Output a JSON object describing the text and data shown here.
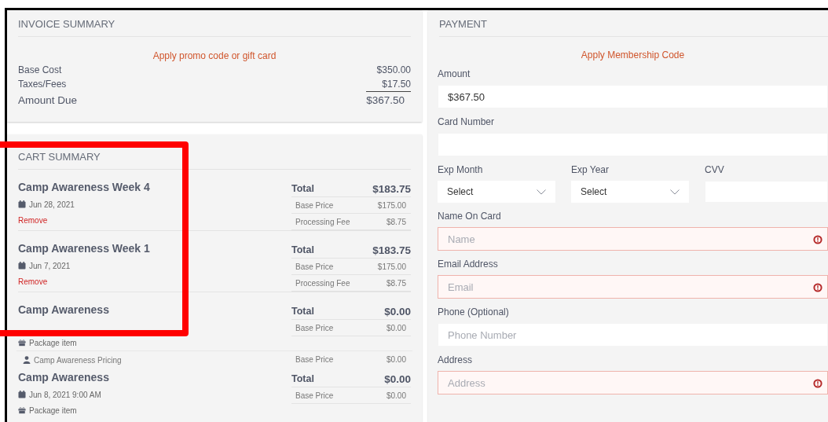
{
  "invoice": {
    "title": "INVOICE SUMMARY",
    "promo_link": "Apply promo code or gift card",
    "lines": [
      {
        "kind": "line",
        "label": "Base Cost",
        "value": "$350.00"
      },
      {
        "kind": "subtotal",
        "label": "Taxes/Fees",
        "value": "$17.50"
      },
      {
        "kind": "due",
        "label": "Amount Due",
        "value": "$367.50"
      }
    ]
  },
  "cart": {
    "title": "CART SUMMARY",
    "items": [
      {
        "name": "Camp Awareness Week 4",
        "date": "Jun 28, 2021",
        "remove": "Remove",
        "total_label": "Total",
        "total": "$183.75",
        "fees": [
          {
            "label": "Base Price",
            "value": "$175.00"
          },
          {
            "label": "Processing Fee",
            "value": "$8.75"
          }
        ]
      },
      {
        "name": "Camp Awareness Week 1",
        "date": "Jun 7, 2021",
        "remove": "Remove",
        "total_label": "Total",
        "total": "$183.75",
        "fees": [
          {
            "label": "Base Price",
            "value": "$175.00"
          },
          {
            "label": "Processing Fee",
            "value": "$8.75"
          }
        ]
      },
      {
        "name": "Camp Awareness",
        "package": "Package item",
        "total_label": "Total",
        "total": "$0.00",
        "fees": [
          {
            "label": "Base Price",
            "value": "$0.00"
          }
        ],
        "sub": {
          "name": "Camp Awareness Pricing",
          "label": "Base Price",
          "value": "$0.00"
        }
      },
      {
        "name": "Camp Awareness",
        "date": "Jun 8, 2021 9:00 AM",
        "package": "Package item",
        "total_label": "Total",
        "total": "$0.00",
        "fees": [
          {
            "label": "Base Price",
            "value": "$0.00"
          }
        ]
      }
    ]
  },
  "payment": {
    "title": "PAYMENT",
    "membership_link": "Apply Membership Code",
    "fields": [
      {
        "kind": "input",
        "label": "Amount",
        "value": "$367.50",
        "invalid": false
      },
      {
        "kind": "input",
        "label": "Card Number",
        "invalid": false
      },
      {
        "kind": "row",
        "cells": [
          {
            "kind": "select",
            "label": "Exp Month",
            "value": "Select"
          },
          {
            "kind": "select",
            "label": "Exp Year",
            "value": "Select"
          },
          {
            "kind": "input",
            "label": "CVV"
          }
        ]
      },
      {
        "kind": "input",
        "label": "Name On Card",
        "placeholder": "Name",
        "invalid": true
      },
      {
        "kind": "input",
        "label": "Email Address",
        "placeholder": "Email",
        "invalid": true
      },
      {
        "kind": "input",
        "label": "Phone (Optional)",
        "placeholder": "Phone Number",
        "invalid": false
      },
      {
        "kind": "input",
        "label": "Address",
        "placeholder": "Address",
        "invalid": true
      }
    ]
  }
}
